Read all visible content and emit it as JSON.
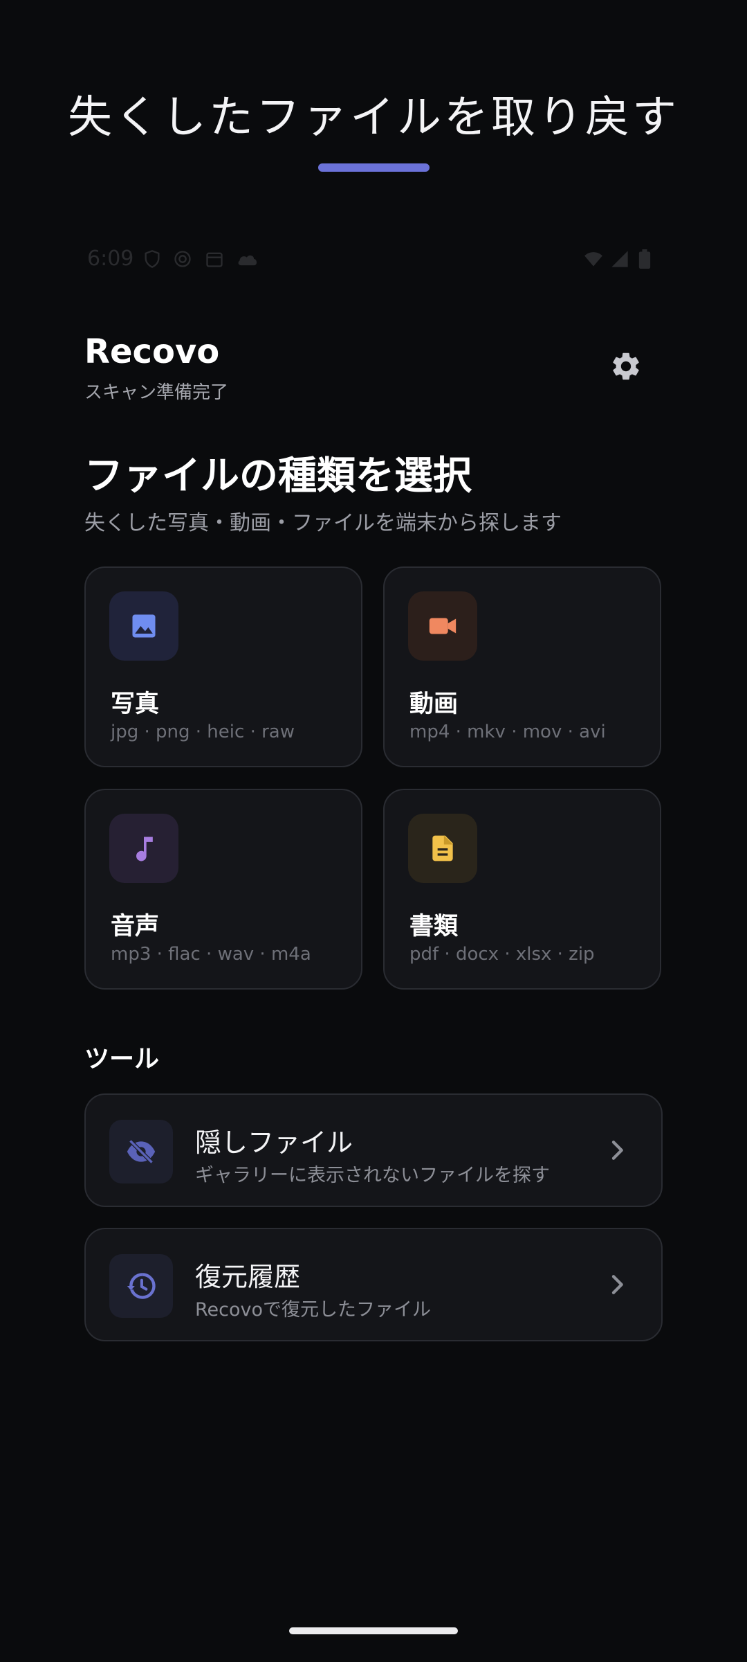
{
  "banner": {
    "title": "失くしたファイルを取り戻す",
    "accent_color": "#6b72d8"
  },
  "status_bar": {
    "time": "6:09",
    "icons": [
      "shield-icon",
      "at-sign-icon",
      "calendar-icon",
      "cloud-icon",
      "wifi-icon",
      "signal-icon",
      "battery-icon"
    ]
  },
  "header": {
    "app_name": "Recovo",
    "status": "スキャン準備完了",
    "settings_icon": "gear-icon"
  },
  "file_types": {
    "title": "ファイルの種類を選択",
    "subtitle": "失くした写真・動画・ファイルを端末から探します",
    "cards": [
      {
        "label": "写真",
        "extensions": "jpg · png · heic · raw",
        "icon": "image-icon",
        "color": "#6f8df0"
      },
      {
        "label": "動画",
        "extensions": "mp4 · mkv · mov · avi",
        "icon": "video-camera-icon",
        "color": "#f08860"
      },
      {
        "label": "音声",
        "extensions": "mp3 · flac · wav · m4a",
        "icon": "music-note-icon",
        "color": "#a77de0"
      },
      {
        "label": "書類",
        "extensions": "pdf · docx · xlsx · zip",
        "icon": "document-icon",
        "color": "#f1c14a"
      }
    ]
  },
  "tools": {
    "title": "ツール",
    "items": [
      {
        "label": "隠しファイル",
        "description": "ギャラリーに表示されないファイルを探す",
        "icon": "eye-off-icon"
      },
      {
        "label": "復元履歴",
        "description": "Recovoで復元したファイル",
        "icon": "history-icon"
      }
    ]
  }
}
